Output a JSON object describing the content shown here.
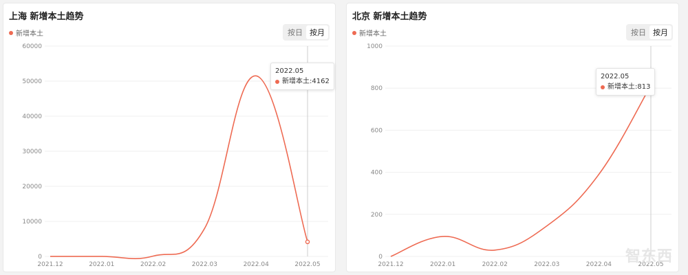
{
  "colors": {
    "line": "#ee6a52",
    "grid": "#efefef",
    "axis_text": "#888888"
  },
  "panels": [
    {
      "title": "上海 新增本土趋势",
      "legend": "新增本土",
      "toggle": [
        "按日",
        "按月"
      ],
      "tooltip": {
        "label": "2022.05",
        "series": "新增本土",
        "value": "4162"
      }
    },
    {
      "title": "北京 新增本土趋势",
      "legend": "新增本土",
      "toggle": [
        "按日",
        "按月"
      ],
      "tooltip": {
        "label": "2022.05",
        "series": "新增本土",
        "value": "813"
      }
    }
  ],
  "chart_data": [
    {
      "type": "line",
      "title": "上海 新增本土趋势",
      "categories": [
        "2021.12",
        "2022.01",
        "2022.02",
        "2022.03",
        "2022.04",
        "2022.05"
      ],
      "series": [
        {
          "name": "新增本土",
          "values": [
            5,
            10,
            100,
            8000,
            51500,
            4162
          ]
        }
      ],
      "ylim": [
        0,
        60000
      ],
      "yticks": [
        0,
        10000,
        20000,
        30000,
        40000,
        50000,
        60000
      ],
      "highlight_index": 5
    },
    {
      "type": "line",
      "title": "北京 新增本土趋势",
      "categories": [
        "2021.12",
        "2022.01",
        "2022.02",
        "2022.03",
        "2022.04",
        "2022.05"
      ],
      "series": [
        {
          "name": "新增本土",
          "values": [
            0,
            95,
            30,
            145,
            390,
            813
          ]
        }
      ],
      "ylim": [
        0,
        1000
      ],
      "yticks": [
        0,
        200,
        400,
        600,
        800,
        1000
      ],
      "highlight_index": 5
    }
  ],
  "watermark": "智东西"
}
